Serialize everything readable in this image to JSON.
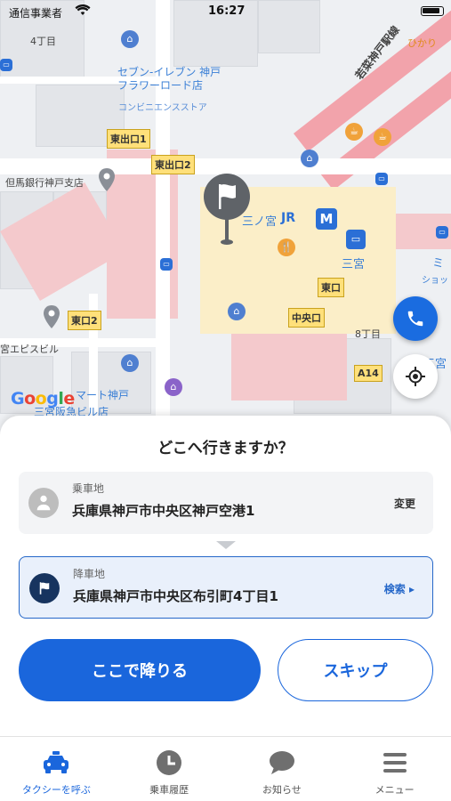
{
  "status_bar": {
    "carrier": "通信事業者",
    "time": "16:27"
  },
  "map": {
    "labels": {
      "chome4": "4丁目",
      "seven_eleven": "セブン-イレブン 神戸\nフラワーロード店",
      "convenience": "コンビニエンスストア",
      "tajima_bank": "但馬銀行神戸支店",
      "sannomiya": "三ノ宮",
      "jr": "JR",
      "sannomiya2": "三宮",
      "wakana": "若菜神戸駅線",
      "hikari": "ひかり",
      "chome8": "8丁目",
      "epi_building": "宮エピスビル",
      "hankyu": "三宮阪急ビル店",
      "mart": "マート神戸",
      "sannomiya3": "三宮",
      "shop": "ショッ",
      "mi": "ミ"
    },
    "exits": {
      "east1": "東出口1",
      "east2": "東出口2",
      "east2b": "東口2",
      "east": "東口",
      "central": "中央口",
      "a14": "A14"
    },
    "google": "Google"
  },
  "sheet": {
    "title": "どこへ行きますか？",
    "pickup": {
      "label": "乗車地",
      "address": "兵庫県神戸市中央区神戸空港1",
      "action": "変更"
    },
    "dropoff": {
      "label": "降車地",
      "address": "兵庫県神戸市中央区布引町4丁目1",
      "action": "検索 ▸"
    },
    "primary_button": "ここで降りる",
    "skip_button": "スキップ"
  },
  "tabs": [
    {
      "label": "タクシーを呼ぶ",
      "icon": "taxi-icon",
      "active": true
    },
    {
      "label": "乗車履歴",
      "icon": "clock-icon",
      "active": false
    },
    {
      "label": "お知らせ",
      "icon": "chat-bubble-icon",
      "active": false
    },
    {
      "label": "メニュー",
      "icon": "menu-icon",
      "active": false
    }
  ],
  "colors": {
    "accent": "#1a66dc",
    "dropoff_bg": "#e9f0fb",
    "pickup_bg": "#f3f4f6"
  }
}
